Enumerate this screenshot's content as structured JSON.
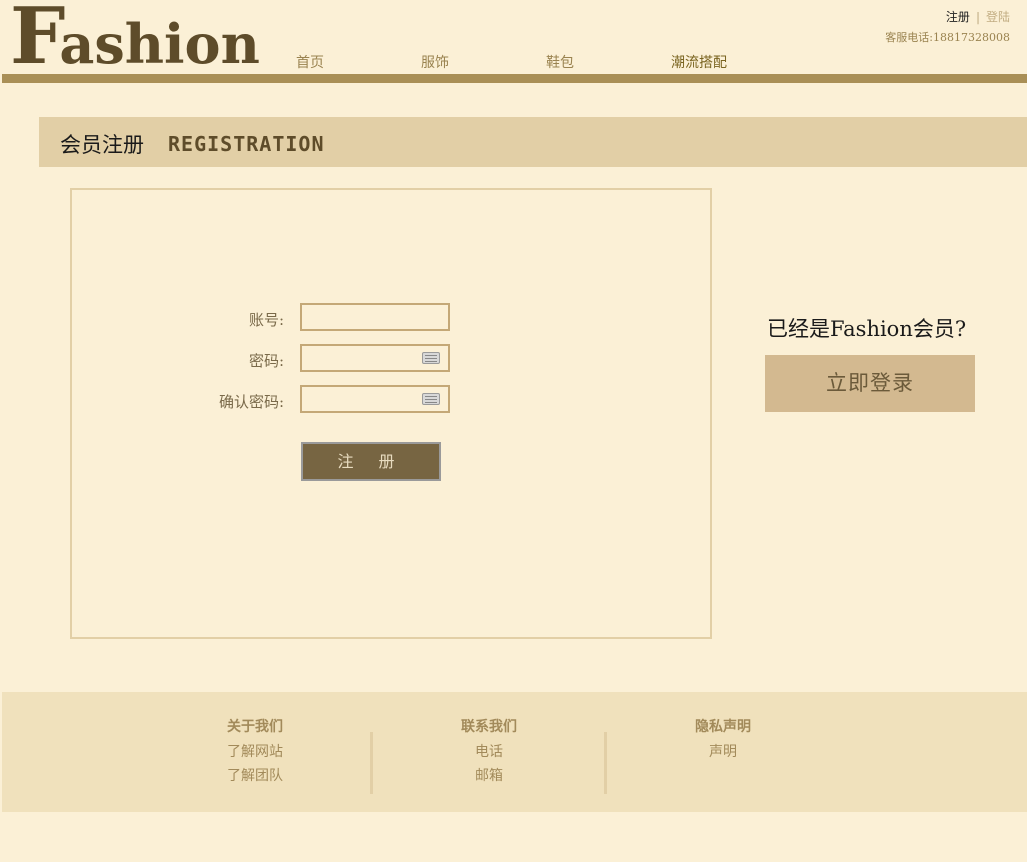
{
  "header": {
    "logo_first": "F",
    "logo_rest": "ashion",
    "nav": [
      {
        "label": "首页"
      },
      {
        "label": "服饰"
      },
      {
        "label": "鞋包"
      },
      {
        "label": "潮流搭配"
      }
    ],
    "register_link": "注册",
    "separator": "|",
    "login_link": "登陆",
    "phone": "客服电话:18817328008"
  },
  "page_title": {
    "cn": "会员注册",
    "en": "REGISTRATION"
  },
  "form": {
    "account_label": "账号:",
    "password_label": "密码:",
    "confirm_label": "确认密码:",
    "account_value": "",
    "password_value": "",
    "confirm_value": "",
    "submit_label": "注 册"
  },
  "side": {
    "question": "已经是Fashion会员?",
    "login_button": "立即登录"
  },
  "footer": {
    "columns": [
      {
        "heading": "关于我们",
        "links": [
          "了解网站",
          "了解团队"
        ]
      },
      {
        "heading": "联系我们",
        "links": [
          "电话",
          "邮箱"
        ]
      },
      {
        "heading": "隐私声明",
        "links": [
          "声明"
        ]
      }
    ]
  },
  "colors": {
    "background": "#fbf0d6",
    "accent_bar": "#a98f56",
    "title_band": "#e2cfa6",
    "button_dark": "#776542",
    "login_button": "#d3b990",
    "footer": "#f0e1bc"
  },
  "icons": [
    "keyboard-icon"
  ]
}
